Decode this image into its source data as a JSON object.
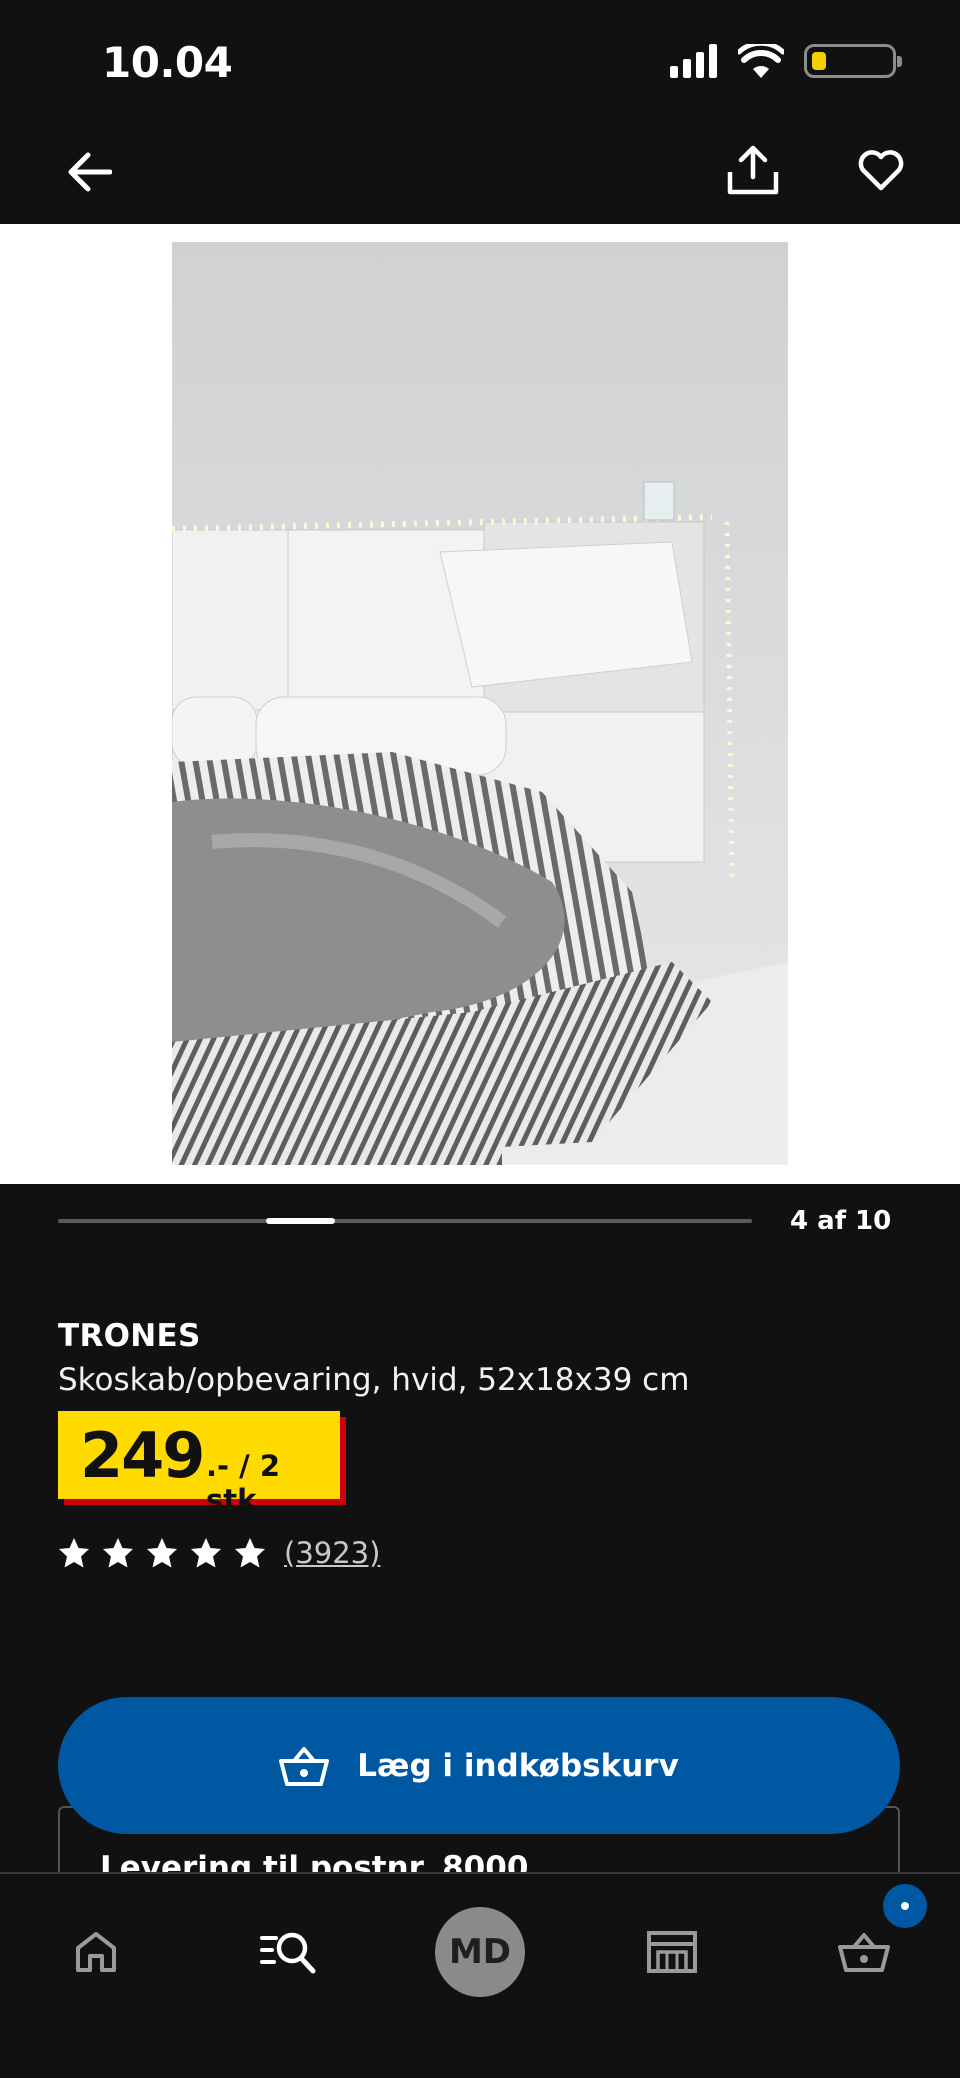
{
  "status_bar": {
    "time": "10.04",
    "icons": [
      "signal-icon",
      "wifi-icon",
      "battery-icon"
    ],
    "battery_color": "#f5d000"
  },
  "nav": {
    "icons": [
      "back-arrow-icon",
      "share-icon",
      "heart-icon"
    ]
  },
  "carousel": {
    "counter": "4 af 10",
    "current": 4,
    "total": 10
  },
  "product": {
    "name": "TRONES",
    "description": "Skoskab/opbevaring, hvid, 52x18x39 cm",
    "price": "249",
    "price_suffix": ".- / 2 stk",
    "rating": 5,
    "review_count": "(3923)"
  },
  "actions": {
    "add_to_cart": "Læg i indkøbskurv"
  },
  "delivery": {
    "label": "Levering til postnr. 8000"
  },
  "tab_bar": {
    "profile_initials": "MD",
    "items": [
      "home-icon",
      "search-icon",
      "profile-avatar",
      "store-icon",
      "cart-icon"
    ],
    "accent_color": "#0058a3"
  },
  "colors": {
    "background": "#111111",
    "price_tag_yellow": "#ffdb00",
    "price_tag_shadow": "#cc0008",
    "primary_blue": "#0058a3"
  }
}
